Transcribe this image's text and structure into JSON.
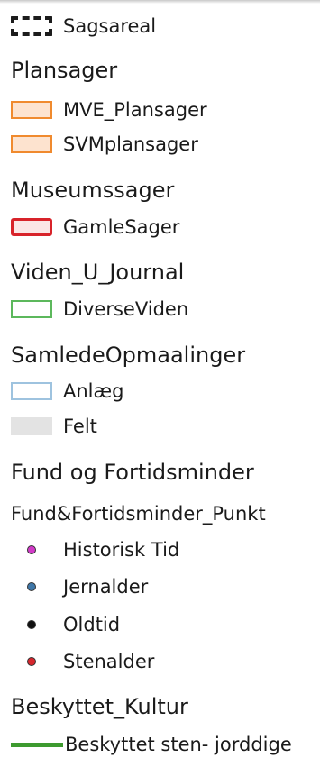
{
  "legend": {
    "sagsareal": {
      "label": "Sagsareal",
      "symbol": "dashed-black-outline"
    },
    "plansager": {
      "title": "Plansager",
      "items": [
        {
          "label": "MVE_Plansager",
          "color": "#f08a2e"
        },
        {
          "label": "SVMplansager",
          "color": "#f08a2e"
        }
      ]
    },
    "museumssager": {
      "title": "Museumssager",
      "items": [
        {
          "label": "GamleSager",
          "color": "#d8232a"
        }
      ]
    },
    "viden": {
      "title": "Viden_U_Journal",
      "items": [
        {
          "label": "DiverseViden",
          "color": "#5cb85c"
        }
      ]
    },
    "opmaalinger": {
      "title": "SamledeOpmaalinger",
      "items": [
        {
          "label": "Anlæg",
          "color": "#9ec3df"
        },
        {
          "label": "Felt",
          "color": "#e3e3e3"
        }
      ]
    },
    "fund": {
      "title": "Fund og Fortidsminder",
      "subtitle": "Fund&Fortidsminder_Punkt",
      "points": [
        {
          "label": "Historisk Tid",
          "color": "#d23ac8"
        },
        {
          "label": "Jernalder",
          "color": "#3f77a8"
        },
        {
          "label": "Oldtid",
          "color": "#111111"
        },
        {
          "label": "Stenalder",
          "color": "#d6262d"
        }
      ]
    },
    "beskyttet": {
      "title": "Beskyttet_Kultur",
      "items": [
        {
          "label": "Beskyttet sten- jorddige",
          "color": "#3d9a2f"
        }
      ]
    }
  }
}
